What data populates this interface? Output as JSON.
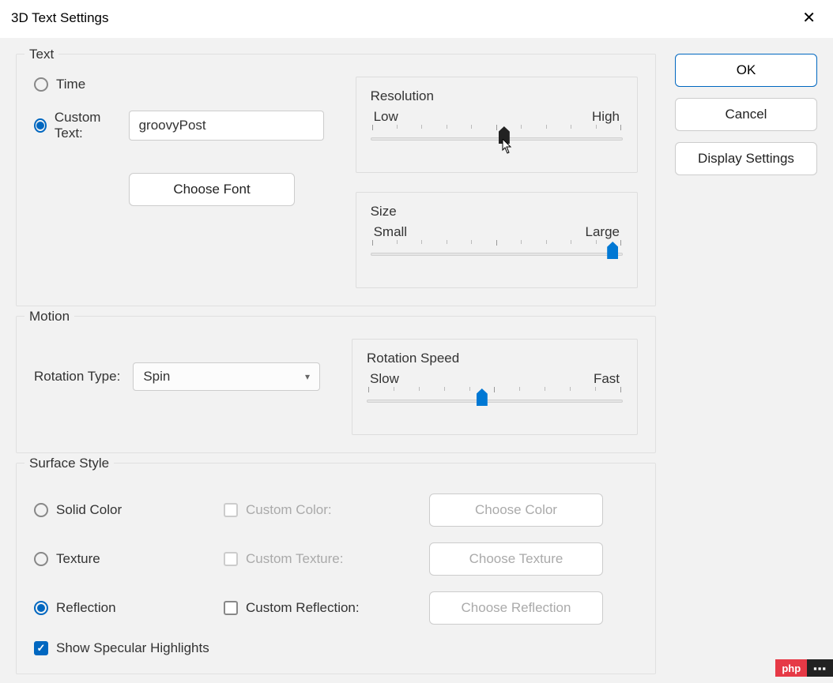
{
  "title": "3D Text Settings",
  "buttons": {
    "ok": "OK",
    "cancel": "Cancel",
    "display": "Display Settings"
  },
  "text_group": {
    "title": "Text",
    "time_label": "Time",
    "custom_label": "Custom Text:",
    "custom_value": "groovyPost",
    "choose_font": "Choose Font",
    "resolution": {
      "title": "Resolution",
      "low": "Low",
      "high": "High",
      "value": 53
    },
    "size": {
      "title": "Size",
      "small": "Small",
      "large": "Large",
      "value": 96
    }
  },
  "motion_group": {
    "title": "Motion",
    "rotation_type_label": "Rotation Type:",
    "rotation_type_value": "Spin",
    "speed": {
      "title": "Rotation Speed",
      "slow": "Slow",
      "fast": "Fast",
      "value": 45
    }
  },
  "surface_group": {
    "title": "Surface Style",
    "solid": "Solid Color",
    "texture": "Texture",
    "reflection": "Reflection",
    "custom_color": "Custom Color:",
    "custom_texture": "Custom Texture:",
    "custom_reflection": "Custom Reflection:",
    "choose_color": "Choose Color",
    "choose_texture": "Choose Texture",
    "choose_reflection": "Choose Reflection",
    "specular": "Show Specular Highlights"
  },
  "watermark": {
    "left": "php",
    "right": "▪▪▪"
  }
}
